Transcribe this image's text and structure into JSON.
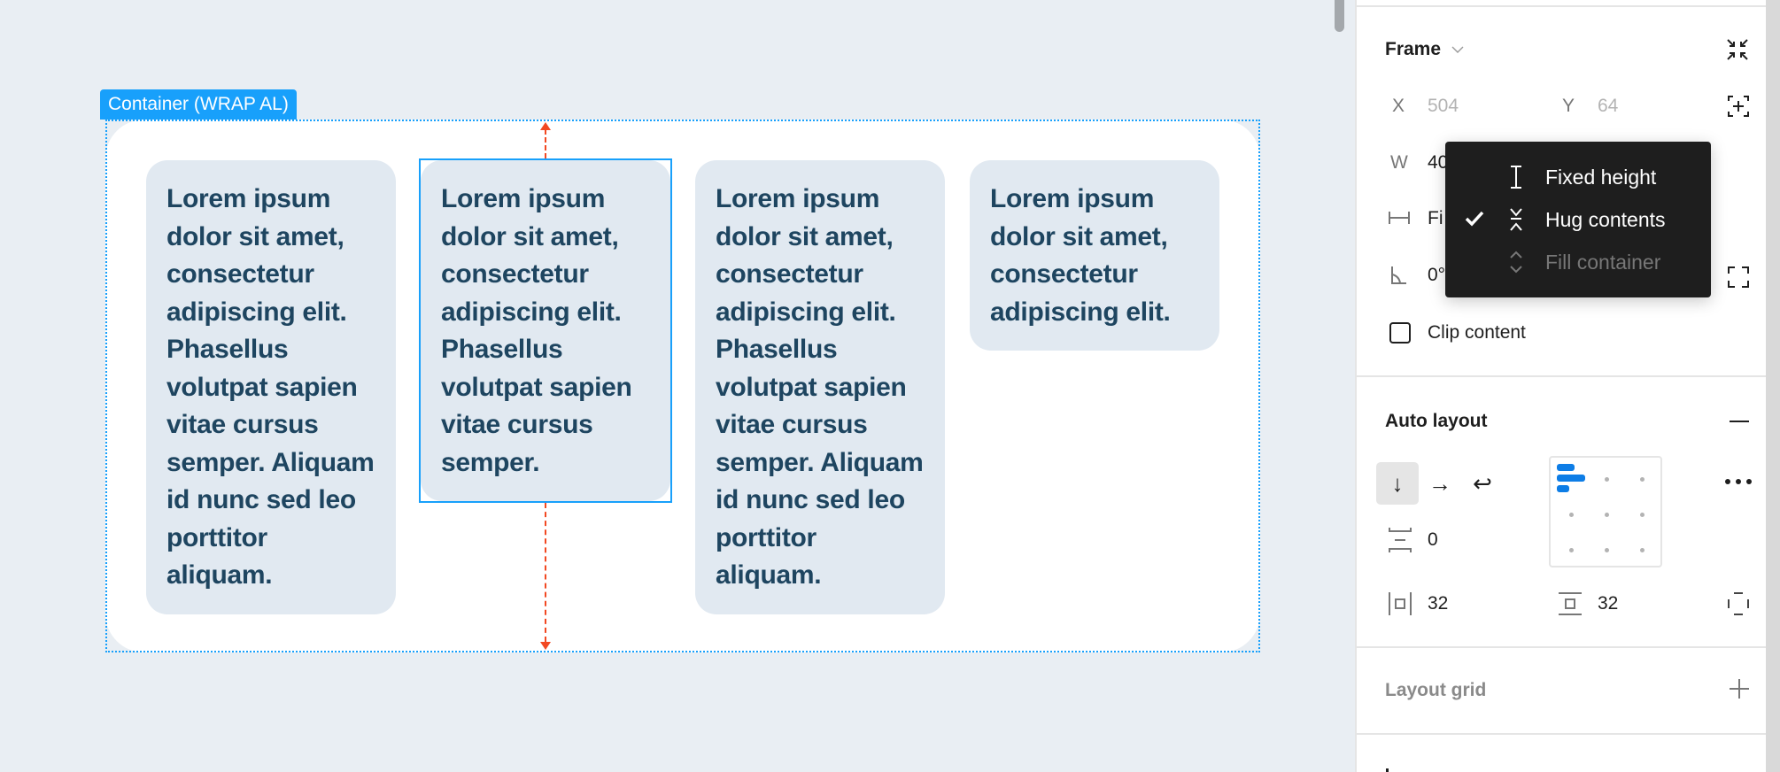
{
  "canvas": {
    "container_label": "Container (WRAP AL)",
    "cards": [
      {
        "text": "Lorem ipsum dolor sit amet, consectetur adipiscing elit. Phasellus volutpat sapien vitae cursus semper. Aliquam id nunc sed leo porttitor aliquam.",
        "selected": false
      },
      {
        "text": "Lorem ipsum dolor sit amet, consectetur adipiscing elit. Phasellus volutpat sapien vitae cursus semper.",
        "selected": true
      },
      {
        "text": "Lorem ipsum dolor sit amet, consectetur adipiscing elit. Phasellus volutpat sapien vitae cursus semper. Aliquam id nunc sed leo porttitor aliquam.",
        "selected": false
      },
      {
        "text": "Lorem ipsum dolor sit amet, consectetur adipiscing elit.",
        "selected": false
      }
    ],
    "colors": {
      "selection": "#18a0fb",
      "measure": "#f24822",
      "card_bg": "#e1e9f1",
      "card_text": "#1e4560"
    }
  },
  "panel": {
    "frame": {
      "title": "Frame",
      "x_label": "X",
      "x_value": "504",
      "y_label": "Y",
      "y_value": "64",
      "w_label": "W",
      "w_value_partial": "40",
      "width_mode_partial": "Fi",
      "rotation_partial": "0°",
      "clip_content_label": "Clip content",
      "clip_content_checked": false
    },
    "sizing_menu": {
      "items": [
        {
          "label": "Fixed height",
          "icon": "fixed-height-icon",
          "checked": false,
          "disabled": false
        },
        {
          "label": "Hug contents",
          "icon": "hug-contents-icon",
          "checked": true,
          "disabled": false
        },
        {
          "label": "Fill container",
          "icon": "fill-container-icon",
          "checked": false,
          "disabled": true
        }
      ]
    },
    "auto_layout": {
      "title": "Auto layout",
      "direction": "vertical",
      "direction_glyphs": {
        "vertical": "↓",
        "horizontal": "→",
        "wrap": "↩"
      },
      "spacing_between": "0",
      "padding_horizontal": "32",
      "padding_vertical": "32",
      "alignment": "top-left"
    },
    "layout_grid": {
      "title": "Layout grid"
    },
    "colors": {
      "accent": "#0d7de6"
    }
  }
}
